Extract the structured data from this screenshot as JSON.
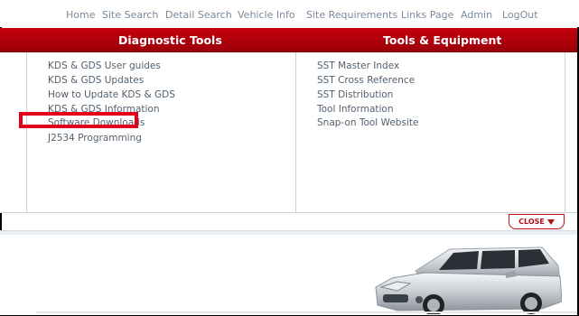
{
  "nav": {
    "items": [
      "Home",
      "Site Search",
      "Detail Search",
      "Vehicle Info",
      "Site Requirements",
      "Links Page",
      "Admin",
      "LogOut"
    ]
  },
  "headers": {
    "diagnostic": "Diagnostic Tools",
    "tools": "Tools & Equipment"
  },
  "diagnostic_links": [
    "KDS & GDS User guides",
    "KDS & GDS Updates",
    "How to Update KDS & GDS",
    "KDS & GDS Information",
    "Software Downloads",
    "J2534 Programming"
  ],
  "tools_links": [
    "SST Master Index",
    "SST Cross Reference",
    "SST Distribution",
    "Tool Information",
    "Snap-on Tool Website"
  ],
  "close_label": "CLOSE",
  "colors": {
    "brand_red": "#c5000b",
    "highlight": "#e3001b",
    "link": "#52616f",
    "nav": "#7a8a9a"
  }
}
